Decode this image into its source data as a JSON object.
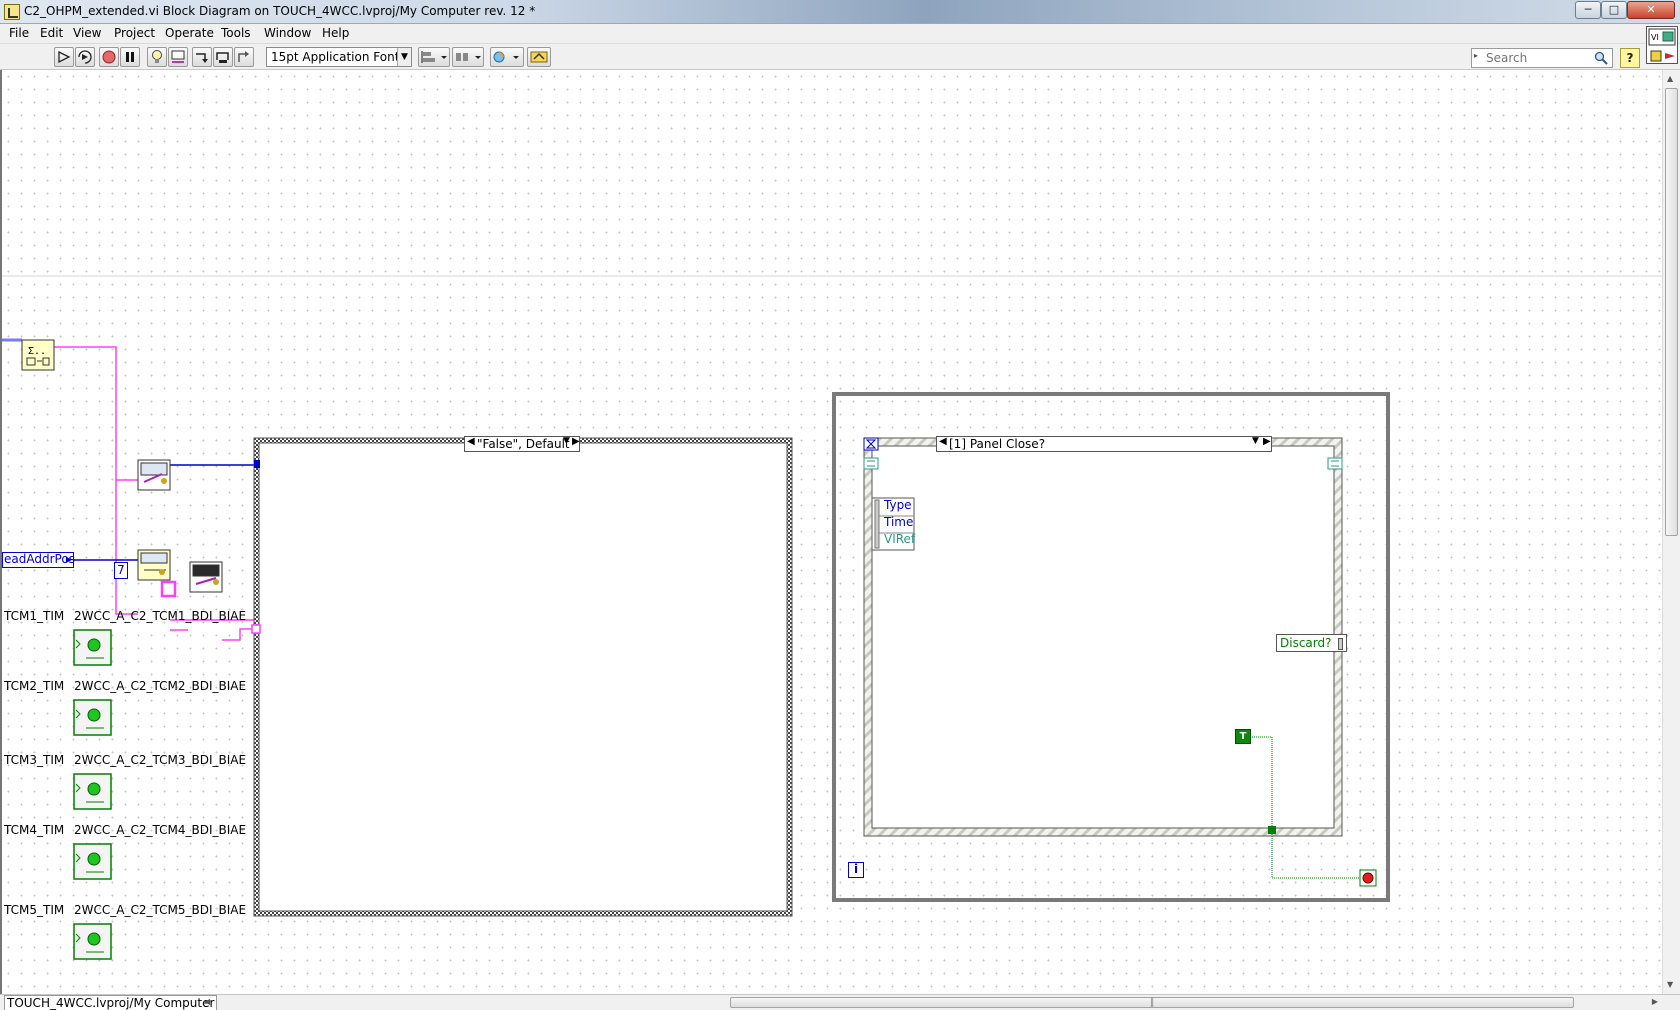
{
  "window": {
    "title": "C2_OHPM_extended.vi Block Diagram on TOUCH_4WCC.lvproj/My Computer rev. 12 *",
    "min_glyph": "─",
    "max_glyph": "□",
    "close_glyph": "✕"
  },
  "menu": [
    "File",
    "Edit",
    "View",
    "Project",
    "Operate",
    "Tools",
    "Window",
    "Help"
  ],
  "toolbar": {
    "font": "15pt Application Font",
    "search_placeholder": "Search",
    "help_glyph": "?"
  },
  "diagram": {
    "case_structure_selector": "\"False\", Default",
    "event_selector": "[1] Panel Close?",
    "event_data": [
      "Type",
      "Time",
      "VIRef"
    ],
    "discard_label": "Discard?",
    "bool_true": "T",
    "loop_iteration": "i",
    "read_addr_label": "eadAddrPos",
    "numeric_constant": "7",
    "indicators": [
      {
        "left": "TCM1_TIM",
        "right": "2WCC_A_C2_TCM1_BDI_BIAE"
      },
      {
        "left": "TCM2_TIM",
        "right": "2WCC_A_C2_TCM2_BDI_BIAE"
      },
      {
        "left": "TCM3_TIM",
        "right": "2WCC_A_C2_TCM3_BDI_BIAE"
      },
      {
        "left": "TCM4_TIM",
        "right": "2WCC_A_C2_TCM4_BDI_BIAE"
      },
      {
        "left": "TCM5_TIM",
        "right": "2WCC_A_C2_TCM5_BDI_BIAE"
      }
    ]
  },
  "status": {
    "context": "TOUCH_4WCC.lvproj/My Computer"
  },
  "colors": {
    "wire_pink": "#ff40ff",
    "wire_blue": "#0000c8",
    "wire_green": "#008000",
    "structure_gray": "#7a7a7a",
    "led_green": "#22c422"
  }
}
